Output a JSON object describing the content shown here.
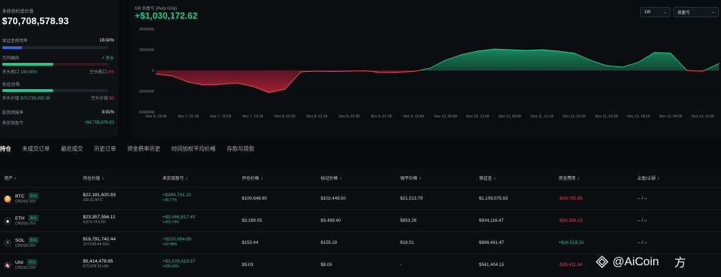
{
  "summary": {
    "total_label": "永续合约总价值",
    "total_value": "$70,708,578.93",
    "margin_label": "保证金使用率",
    "margin_value": "19.02%",
    "margin_pct": 19.02,
    "direction_label": "方向偏向",
    "direction_value": "多头",
    "long_exposure_label": "多头敞口",
    "long_exposure_value": "100.00%",
    "short_exposure_label": "空头敞口",
    "short_exposure_value": "0%",
    "position_dist_label": "仓位分布",
    "long_value_label": "多头价值",
    "long_value": "$70,738,295.38",
    "short_value_label": "空头价值",
    "short_value": "$0",
    "roe_label": "投资回报率",
    "roe_value": "9.01%",
    "upnl_label": "未实现盈亏",
    "upnl_value": "+$4,705,976.93"
  },
  "chart": {
    "title": "1W 总盈亏 (Perp Only)",
    "value": "+$1,030,172.62",
    "range_select": "1W",
    "metric_select": "总盈亏"
  },
  "chart_data": {
    "type": "area",
    "title": "1W 总盈亏 (Perp Only)",
    "yticks": [
      "6000000",
      "3000000",
      "0",
      "-3000000",
      "-6000000"
    ],
    "ylim": [
      -6000000,
      6000000
    ],
    "xticks": [
      "Nov 6, 16:58",
      "Nov 7, 01:38",
      "Nov 7, 10:18",
      "Nov 7, 19:18",
      "Nov 8, 03:38",
      "Nov 8, 12:18",
      "Nov 8, 22:38",
      "Nov 9, 07:18",
      "Nov 9, 15:58",
      "Nov 10, 00:58",
      "Nov 10, 13:58",
      "Nov 11, 00:58",
      "Nov 11, 12:18",
      "Nov 12, 00:58",
      "Nov 12, 09:38",
      "Nov 12, 18:18",
      "Nov 13, 04:58",
      "Nov 13, 13:38"
    ],
    "x": [
      0,
      0.5,
      1,
      1.5,
      2,
      2.5,
      3,
      3.5,
      4,
      4.5,
      5,
      5.5,
      6,
      6.5,
      7,
      7.5,
      8,
      8.5,
      9,
      9.5,
      10,
      10.5,
      11,
      11.5,
      12,
      12.5,
      13,
      13.5,
      14,
      14.5,
      15,
      15.5,
      16,
      16.5,
      17,
      17.5
    ],
    "series": [
      {
        "values": [
          -500000,
          -800000,
          -1700000,
          -2100000,
          -2000000,
          -1800000,
          -2300000,
          -3200000,
          -2700000,
          -200000,
          -100000,
          -150000,
          -100000,
          -50000,
          -300000,
          -250000,
          -150000,
          300000,
          1500000,
          2300000,
          2800000,
          3100000,
          3000000,
          2900000,
          3000000,
          2800000,
          2500000,
          1500000,
          700000,
          500000,
          1200000,
          2600000,
          2500000,
          0,
          -100000,
          1000000
        ]
      }
    ]
  },
  "tabs": [
    "持仓",
    "未成交订单",
    "最近成交",
    "历史订单",
    "资金费率历史",
    "时间加权平均价格",
    "存款与提款"
  ],
  "table": {
    "headers": [
      "资产",
      "持仓价值",
      "未实现盈亏",
      "开仓价格",
      "标记价格",
      "强平价格",
      "保证金",
      "资金费用",
      "止盈/止损"
    ],
    "rows": [
      {
        "coin": "BTC",
        "side": "多头",
        "mode": "CROSS 20X",
        "value": "$22,181,620.93",
        "size": "216.51 BTC",
        "pnl": "+$389,741.21",
        "pnl_pct": "+35.77%",
        "entry": "$100,648.90",
        "mark": "$102,449.50",
        "liq": "$21,513.79",
        "margin": "$1,109,075.63",
        "funding": "-$49,760.86",
        "tpsl": "-- / --",
        "color": "#f7931a",
        "icon": "₿"
      },
      {
        "coin": "ETH",
        "side": "多头",
        "mode": "CROSS 25X",
        "value": "$23,357,584.11",
        "size": "6,674.74 ETH",
        "pnl": "+$2,066,817.40",
        "pnl_pct": "+242.74%",
        "entry": "$3,189.05",
        "mark": "$3,499.40",
        "liq": "$853.26",
        "margin": "$934,116.47",
        "funding": "-$36,336.13",
        "tpsl": "-- / --",
        "color": "#0b0e11",
        "icon": "◆"
      },
      {
        "coin": "SOL",
        "side": "多头",
        "mode": "CROSS 20X",
        "value": "$19,791,742.44",
        "size": "127,536.44 SOL",
        "pnl": "+$220,004.95",
        "pnl_pct": "+22.48%",
        "entry": "$153.44",
        "mark": "$155.19",
        "liq": "$16.01",
        "margin": "$989,491.47",
        "funding": "+$16,519.20",
        "tpsl": "-- / --",
        "color": "#0b0e11",
        "icon": "≡"
      },
      {
        "coin": "UNI",
        "side": "多头",
        "mode": "CROSS 10X",
        "value": "$5,414,478.95",
        "size": "672,978.10 UNI",
        "pnl": "+$2,029,413.37",
        "pnl_pct": "+599.60%",
        "entry": "$5.03",
        "mark": "$8.05",
        "liq": "-",
        "margin": "$541,404.15",
        "funding": "-$26,411.34",
        "tpsl": "-- / --",
        "color": "#0b0e11",
        "icon": "🦄"
      }
    ]
  },
  "watermark": {
    "brand": "@AiCoin",
    "suffix": "方"
  },
  "colors": {
    "green": "#22c88b",
    "red": "#ef3e5b",
    "bg": "#07090b"
  }
}
